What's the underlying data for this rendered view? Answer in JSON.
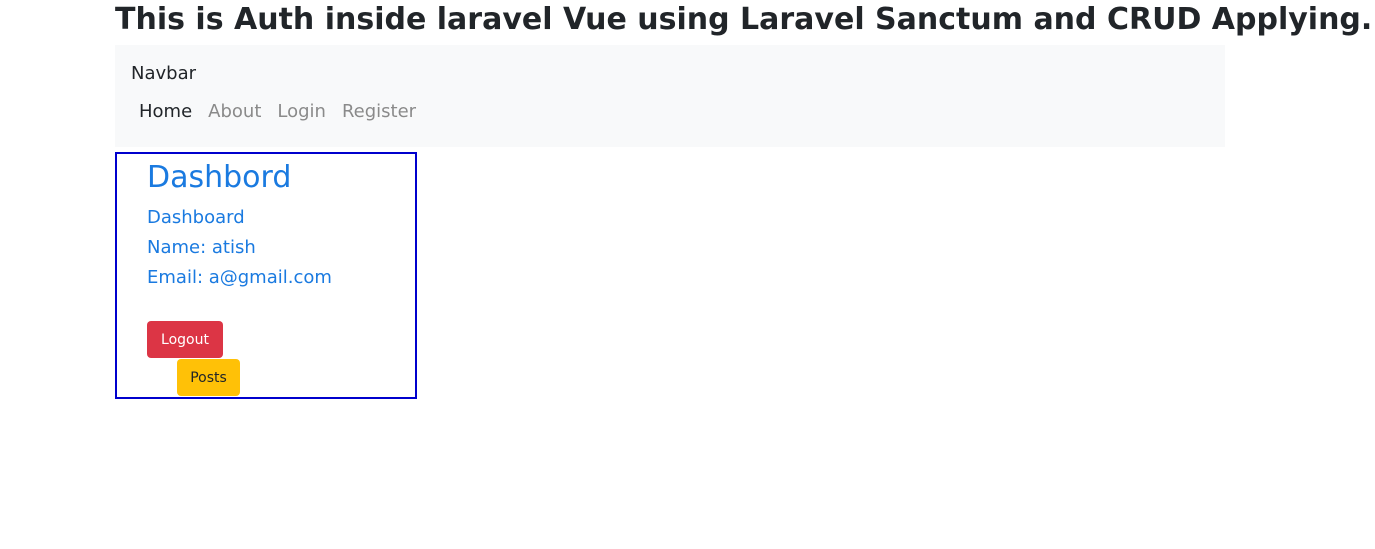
{
  "page": {
    "title": "This is Auth inside laravel Vue using Laravel Sanctum and CRUD Applying."
  },
  "navbar": {
    "brand": "Navbar",
    "links": [
      {
        "label": "Home",
        "active": true
      },
      {
        "label": "About",
        "active": false
      },
      {
        "label": "Login",
        "active": false
      },
      {
        "label": "Register",
        "active": false
      }
    ]
  },
  "dashboard": {
    "heading": "Dashbord",
    "subtitle": "Dashboard",
    "name_line": "Name: atish",
    "email_line": "Email: a@gmail.com",
    "logout_label": "Logout",
    "posts_label": "Posts"
  },
  "colors": {
    "navbar_bg": "#f8f9fa",
    "card_border": "#0000cd",
    "link_blue": "#1a7ae0",
    "logout_red": "#dc3545",
    "posts_yellow": "#ffc107"
  }
}
